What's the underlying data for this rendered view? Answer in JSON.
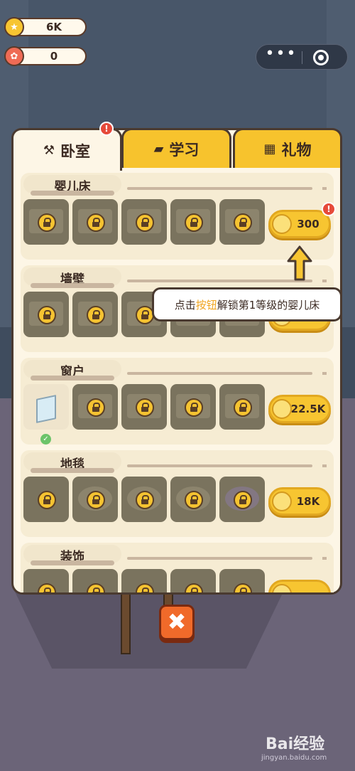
{
  "hud": {
    "coins": "6K",
    "flowers": "0"
  },
  "tabs": [
    {
      "label": "卧室",
      "icon": "hammer-icon",
      "active": true,
      "alert": "!"
    },
    {
      "label": "学习",
      "icon": "graduation-cap-icon",
      "active": false
    },
    {
      "label": "礼物",
      "icon": "gift-icon",
      "active": false
    }
  ],
  "sections": [
    {
      "title": "婴儿床",
      "price": "300",
      "alert": "!",
      "items": [
        "crib-1",
        "crib-2",
        "crib-3",
        "crib-4",
        "crib-5"
      ]
    },
    {
      "title": "墙壁",
      "price": "",
      "items": [
        "wall-1",
        "wall-2",
        "wall-3",
        "wall-4",
        "wall-5"
      ]
    },
    {
      "title": "窗户",
      "price": "22.5K",
      "items": [
        "window-1",
        "window-2",
        "window-3",
        "window-4",
        "window-5"
      ],
      "unlocked_index": 0,
      "unlocked_check": "✓"
    },
    {
      "title": "地毯",
      "price": "18K",
      "items": [
        "rug-1",
        "rug-2",
        "rug-3",
        "rug-4",
        "rug-5"
      ]
    },
    {
      "title": "装饰",
      "price": "",
      "items": [
        "deco-1",
        "deco-2",
        "deco-3",
        "deco-4",
        "deco-5"
      ]
    }
  ],
  "tooltip": {
    "prefix": "点击",
    "highlight": "按钮",
    "suffix": "解锁第1等级的婴儿床"
  },
  "close_button": "✖",
  "watermark": {
    "logo": "Bai经验",
    "url": "jingyan.baidu.com"
  },
  "colors": {
    "accent": "#f7c531",
    "panel": "#fdf6e6",
    "close": "#f06a2a",
    "highlight": "#f0a51f"
  }
}
